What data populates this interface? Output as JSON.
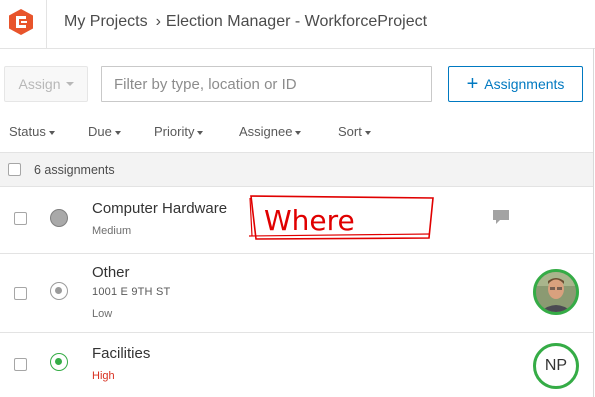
{
  "header": {
    "logo": "workforce-logo-icon",
    "breadcrumb": {
      "root": "My Projects",
      "separator": "›",
      "current": "Election Manager - WorkforceProject"
    }
  },
  "toolbar": {
    "assign_label": "Assign",
    "filter_placeholder": "Filter by type, location or ID",
    "add_assignments_icon": "plus-icon",
    "add_assignments_label": "Assignments"
  },
  "sortbar": {
    "status": "Status",
    "due": "Due",
    "priority": "Priority",
    "assignee": "Assignee",
    "sort": "Sort"
  },
  "list": {
    "count_label": "6 assignments",
    "items": [
      {
        "title": "Computer Hardware",
        "location": "",
        "priority": "Medium",
        "status_icon": "unassigned-status-icon",
        "trailing": "comment-icon",
        "annotation_text": "Where"
      },
      {
        "title": "Other",
        "location": "1001 E 9TH ST",
        "priority": "Low",
        "status_icon": "assigned-status-icon",
        "trailing": "worker-avatar-photo"
      },
      {
        "title": "Facilities",
        "location": "",
        "priority": "High",
        "status_icon": "in-progress-status-icon",
        "trailing": "worker-avatar-initials",
        "avatar_initials": "NP"
      }
    ]
  },
  "colors": {
    "accent": "#0079c1",
    "logo": "#e8542b",
    "assigned_green": "#35ac46",
    "high_priority": "#d83020",
    "annotation_red": "#e00000"
  }
}
